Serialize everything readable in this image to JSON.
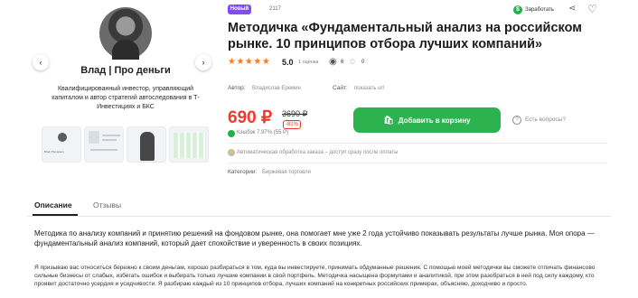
{
  "gallery": {
    "author_title": "Влад | Про деньги",
    "author_desc": "Квалифицированный инвестор, управляющий капиталом и автор стратегий автоследования в Т-Инвестициях и БКС",
    "prev_arrow": "‹",
    "next_arrow": "›",
    "thumb1_caption": "Влад | Про деньги"
  },
  "header": {
    "badge": "Новый",
    "views": "2117",
    "earn_label": "Заработать",
    "earn_icon": "$"
  },
  "product": {
    "title": "Методичка «Фундаментальный анализ на российском рынке. 10 принципов отбора лучших компаний»",
    "stars": "★★★★★",
    "rating": "5.0",
    "rating_count": "1 оценка",
    "eye_count": "6",
    "chat_count": "0",
    "author_label": "Автор:",
    "author_name": "Владислав Еремин",
    "site_label": "Сайт:",
    "site_value": "показать url",
    "price": "690 ₽",
    "old_price": "3690 ₽",
    "discount": "-81%",
    "cashback": "Кэшбэк 7.97% (55 Р)",
    "buy_label": "Добавить в корзину",
    "ask_label": "Есть вопросы?",
    "auto_note": "Автоматическая обработка заказа – доступ сразу после оплаты",
    "category_label": "Категории:",
    "category_value": "Биржевая торговля"
  },
  "tabs": {
    "description": "Описание",
    "reviews": "Отзывы"
  },
  "description": {
    "p1": "Методика по анализу компаний и принятию решений на фондовом рынке, она помогает мне уже 2 года устойчиво показывать результаты лучше рынка. Моя опора — фундаментальный анализ компаний, который дает спокойствие и уверенность в своих позициях.",
    "p2": "Я призываю вас относиться бережно к своим деньгам, хорошо разбираться в том, куда вы инвестируете, принимать обдуманные решения. С помощью моей методички вы сможете отличать финансово сильные бизнесы от слабых, избегать ошибок и выбирать только лучшие компании в свой портфель. Методичка насыщена формулами и аналитикой, при этом разобраться в ней под силу каждому, кто проявит достаточно усердия и усидчивости. Я разбираю каждый из 10 принципов отбора, лучших компаний на конкретных российских примерах, объясняю, доходчиво и просто."
  },
  "colors": {
    "accent_green": "#2cb34f",
    "price_red": "#ee3a2a",
    "badge_purple": "#7f4cff",
    "star_orange": "#ff7a1a"
  }
}
